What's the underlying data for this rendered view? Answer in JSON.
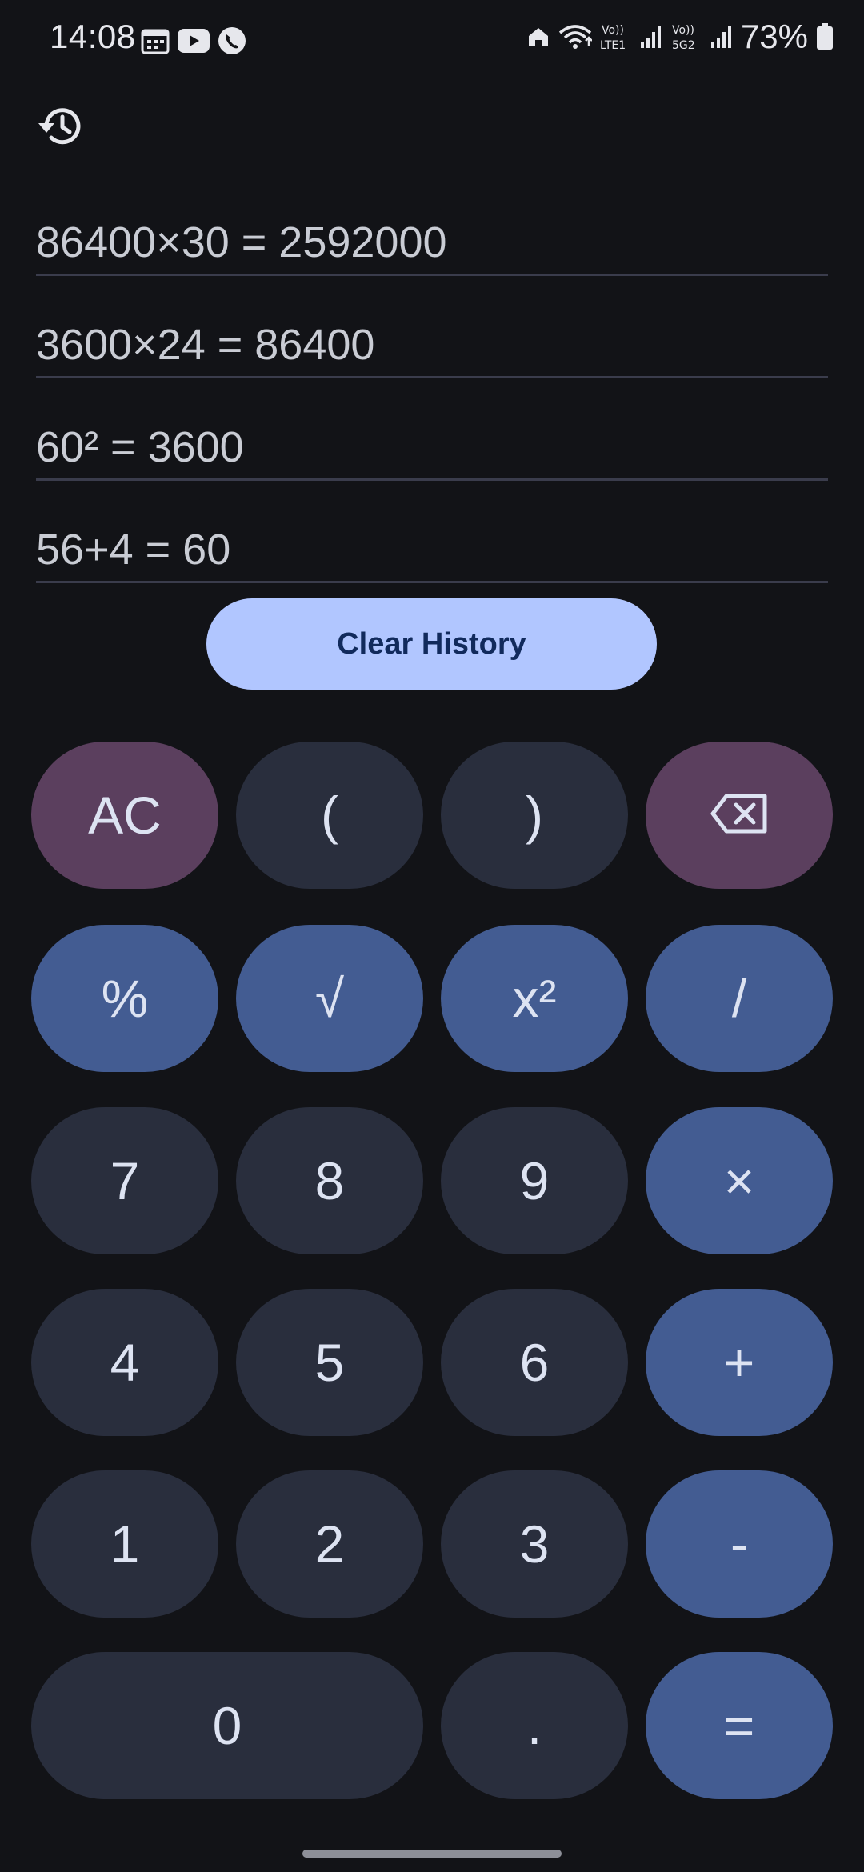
{
  "status_bar": {
    "time": "14:08",
    "battery_percent": "73%",
    "left_icons": [
      "calendar-icon",
      "youtube-icon",
      "phone-call-icon"
    ],
    "right_icons": [
      "home-icon",
      "wifi-icon",
      "volte-lte1-icon",
      "signal-icon",
      "volte-5g2-icon",
      "signal-icon",
      "battery-icon"
    ],
    "volte1_top": "Vo))",
    "volte1_bottom": "LTE1",
    "volte2_top": "Vo))",
    "volte2_bottom": "5G2"
  },
  "history": {
    "icon": "history-icon",
    "items": [
      "86400×30 = 2592000",
      "3600×24 = 86400",
      "60² = 3600",
      "56+4 = 60"
    ],
    "clear_label": "Clear History"
  },
  "keypad": {
    "ac": "AC",
    "lparen": "(",
    "rparen": ")",
    "backspace_icon": "backspace-icon",
    "percent": "%",
    "sqrt": "√",
    "square": "x²",
    "divide": "/",
    "seven": "7",
    "eight": "8",
    "nine": "9",
    "multiply": "×",
    "four": "4",
    "five": "5",
    "six": "6",
    "plus": "+",
    "one": "1",
    "two": "2",
    "three": "3",
    "minus": "-",
    "zero": "0",
    "dot": ".",
    "equals": "="
  },
  "colors": {
    "background": "#121317",
    "number_key": "#292e3d",
    "operator_key": "#435c92",
    "function_key": "#5b3f5e",
    "clear_history_bg": "#b1c6ff",
    "clear_history_text": "#112a5c"
  }
}
